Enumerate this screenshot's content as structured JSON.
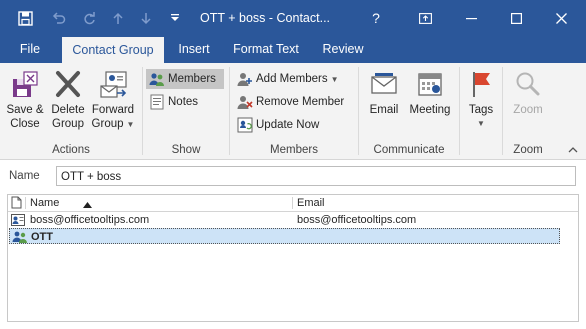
{
  "window": {
    "title": "OTT + boss  -  Contact...",
    "help_label": "?"
  },
  "tabs": [
    {
      "label": "File",
      "active": false
    },
    {
      "label": "Contact Group",
      "active": true
    },
    {
      "label": "Insert",
      "active": false
    },
    {
      "label": "Format Text",
      "active": false
    },
    {
      "label": "Review",
      "active": false
    }
  ],
  "ribbon": {
    "actions": {
      "label": "Actions",
      "save_close": [
        "Save &",
        "Close"
      ],
      "delete_group": [
        "Delete",
        "Group"
      ],
      "forward_group": [
        "Forward",
        "Group"
      ]
    },
    "show": {
      "label": "Show",
      "members": "Members",
      "notes": "Notes"
    },
    "members": {
      "label": "Members",
      "add_members": "Add Members",
      "remove_member": "Remove Member",
      "update_now": "Update Now"
    },
    "communicate": {
      "label": "Communicate",
      "email": "Email",
      "meeting": "Meeting"
    },
    "tags_group": {
      "tags": "Tags"
    },
    "zoom": {
      "label": "Zoom",
      "zoom": "Zoom"
    }
  },
  "name_field": {
    "label": "Name",
    "value": "OTT + boss"
  },
  "members_list": {
    "columns": [
      "Name",
      "Email"
    ],
    "rows": [
      {
        "name": "boss@officetooltips.com",
        "email": "boss@officetooltips.com",
        "icon": "contact-card-icon"
      },
      {
        "name": "OTT",
        "email": "",
        "icon": "contact-group-icon",
        "selected": true
      }
    ]
  },
  "colors": {
    "accent": "#2b579a",
    "ribbon_bg": "#f3f3f3",
    "selected_row": "#cde3f7"
  }
}
